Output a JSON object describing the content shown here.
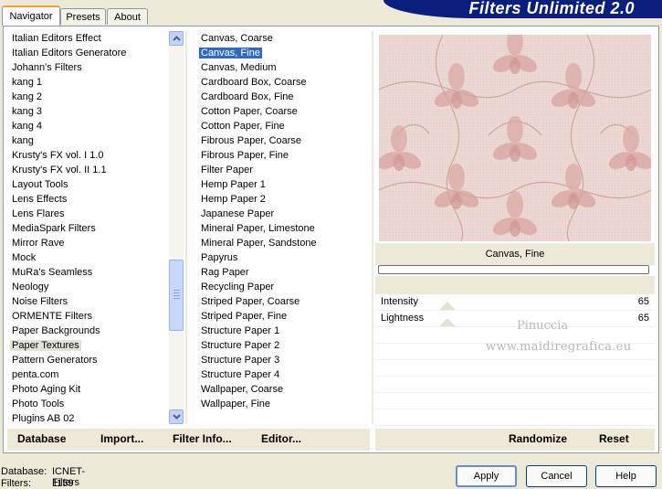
{
  "tabs": [
    {
      "label": "Navigator",
      "active": true
    },
    {
      "label": "Presets",
      "active": false
    },
    {
      "label": "About",
      "active": false
    }
  ],
  "banner_title": "Filters Unlimited 2.0",
  "categories": [
    "Italian Editors Effect",
    "Italian Editors Generatore",
    "Johann's Filters",
    "kang 1",
    "kang 2",
    "kang 3",
    "kang 4",
    "kang",
    "Krusty's FX vol. I 1.0",
    "Krusty's FX vol. II 1.1",
    "Layout Tools",
    "Lens Effects",
    "Lens Flares",
    "MediaSpark Filters",
    "Mirror Rave",
    "Mock",
    "MuRa's Seamless",
    "Neology",
    "Noise Filters",
    "ORMENTE Filters",
    "Paper Backgrounds",
    "Paper Textures",
    "Pattern Generators",
    "penta.com",
    "Photo Aging Kit",
    "Photo Tools",
    "Plugins AB 02"
  ],
  "selected_category": "Paper Textures",
  "filters": [
    "Canvas, Coarse",
    "Canvas, Fine",
    "Canvas, Medium",
    "Cardboard Box, Coarse",
    "Cardboard Box, Fine",
    "Cotton Paper, Coarse",
    "Cotton Paper, Fine",
    "Fibrous Paper, Coarse",
    "Fibrous Paper, Fine",
    "Filter Paper",
    "Hemp Paper 1",
    "Hemp Paper 2",
    "Japanese Paper",
    "Mineral Paper, Limestone",
    "Mineral Paper, Sandstone",
    "Papyrus",
    "Rag Paper",
    "Recycling Paper",
    "Striped Paper, Coarse",
    "Striped Paper, Fine",
    "Structure Paper 1",
    "Structure Paper 2",
    "Structure Paper 3",
    "Structure Paper 4",
    "Wallpaper, Coarse",
    "Wallpaper, Fine"
  ],
  "selected_filter": "Canvas, Fine",
  "preview_filter_name": "Canvas, Fine",
  "params": [
    {
      "label": "Intensity",
      "value": "65"
    },
    {
      "label": "Lightness",
      "value": "65"
    }
  ],
  "watermark": {
    "line1": "Pinuccia",
    "line2": "www.maidiregrafica.eu"
  },
  "links": {
    "database": "Database",
    "import": "Import...",
    "filter_info": "Filter Info...",
    "editor": "Editor...",
    "randomize": "Randomize",
    "reset": "Reset"
  },
  "status": {
    "database_label": "Database:",
    "database_value": "ICNET-Filters",
    "filters_label": "Filters:",
    "filters_value": "1159"
  },
  "buttons": {
    "apply": "Apply",
    "cancel": "Cancel",
    "help": "Help"
  },
  "colors": {
    "selection_blue": "#316ac5",
    "banner": "#0a1f7c",
    "tab_accent": "#f0a030",
    "preview_pink": "#ead4d0"
  }
}
